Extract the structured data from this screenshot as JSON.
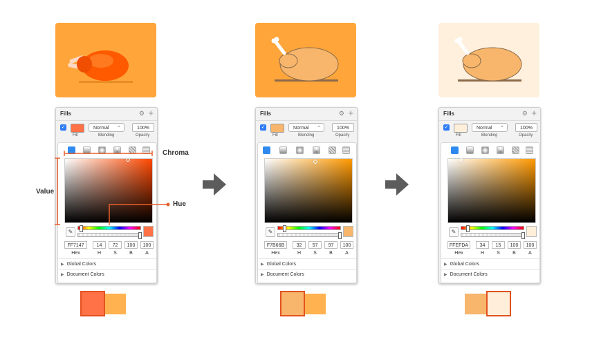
{
  "annotations": {
    "chroma": "Chroma",
    "value": "Value",
    "hue": "Hue"
  },
  "colors": {
    "accent_line": "#e8602c",
    "arrow": "#5c5c5c"
  },
  "panels": [
    {
      "card_bg": "#ffa53a",
      "header": "Fills",
      "fill_color": "#FF7147",
      "blending": "Normal",
      "opacity": "100%",
      "labels": {
        "fill": "Fill",
        "blending": "Blending",
        "opacity": "Opacity"
      },
      "hue_color": "#ff4800",
      "hex": "FF7147",
      "h": "14",
      "s": "72",
      "b": "100",
      "a": "100",
      "field_labels": {
        "hex": "Hex",
        "h": "H",
        "s": "S",
        "b": "B",
        "a": "A"
      },
      "global_colors": "Global Colors",
      "document_colors": "Document Colors",
      "compare": {
        "front": "#FF7147",
        "back": "#FFB24F"
      }
    },
    {
      "card_bg": "#ffa53a",
      "header": "Fills",
      "fill_color": "#F7B66B",
      "blending": "Normal",
      "opacity": "100%",
      "labels": {
        "fill": "Fill",
        "blending": "Blending",
        "opacity": "Opacity"
      },
      "hue_color": "#ff9900",
      "hex": "F7B66B",
      "h": "32",
      "s": "57",
      "b": "97",
      "a": "100",
      "field_labels": {
        "hex": "Hex",
        "h": "H",
        "s": "S",
        "b": "B",
        "a": "A"
      },
      "global_colors": "Global Colors",
      "document_colors": "Document Colors",
      "compare": {
        "front": "#F7B66B",
        "back": "#FFB24F"
      }
    },
    {
      "card_bg": "#fff0dd",
      "header": "Fills",
      "fill_color": "#FFEFDA",
      "blending": "Normal",
      "opacity": "100%",
      "labels": {
        "fill": "Fill",
        "blending": "Blending",
        "opacity": "Opacity"
      },
      "hue_color": "#ff9900",
      "hex": "FFEFDA",
      "h": "34",
      "s": "15",
      "b": "100",
      "a": "100",
      "field_labels": {
        "hex": "Hex",
        "h": "H",
        "s": "S",
        "b": "B",
        "a": "A"
      },
      "global_colors": "Global Colors",
      "document_colors": "Document Colors",
      "compare": {
        "front": "#FFEFDA",
        "back": "#F7B66B"
      }
    }
  ]
}
